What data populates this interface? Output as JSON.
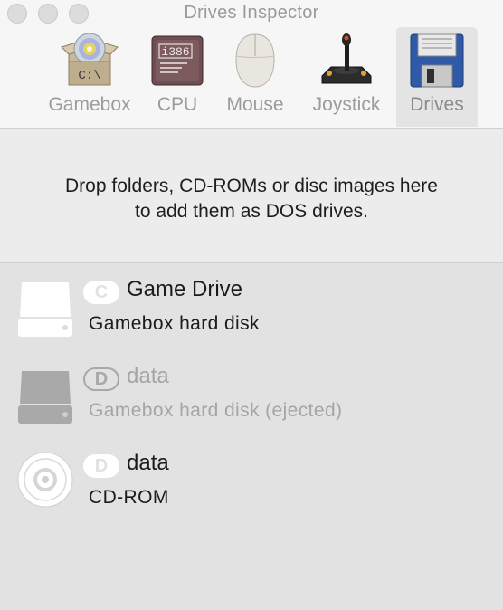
{
  "window": {
    "title": "Drives Inspector"
  },
  "tabs": [
    {
      "label": "Gamebox",
      "icon": "gamebox-icon"
    },
    {
      "label": "CPU",
      "icon": "cpu-chip-icon",
      "chip_text": "i386"
    },
    {
      "label": "Mouse",
      "icon": "mouse-icon"
    },
    {
      "label": "Joystick",
      "icon": "joystick-icon"
    },
    {
      "label": "Drives",
      "icon": "floppy-disk-icon",
      "selected": true
    }
  ],
  "gamebox_icon_text": "C:\\",
  "drop_area": {
    "line1": "Drop folders, CD-ROMs or disc images here",
    "line2": "to add them as DOS drives."
  },
  "drives": [
    {
      "letter": "C",
      "name": "Game Drive",
      "description": "Gamebox hard disk",
      "icon": "hard-disk-icon",
      "ejected": false
    },
    {
      "letter": "D",
      "name": "data",
      "description": "Gamebox hard disk (ejected)",
      "icon": "hard-disk-icon",
      "ejected": true
    },
    {
      "letter": "D",
      "name": "data",
      "description": "CD-ROM",
      "icon": "cd-rom-icon",
      "ejected": false
    }
  ],
  "colors": {
    "selected_tab_bg": "#e4e4e4",
    "list_bg": "#e2e2e2",
    "ejected_text": "#a5a5a5"
  }
}
